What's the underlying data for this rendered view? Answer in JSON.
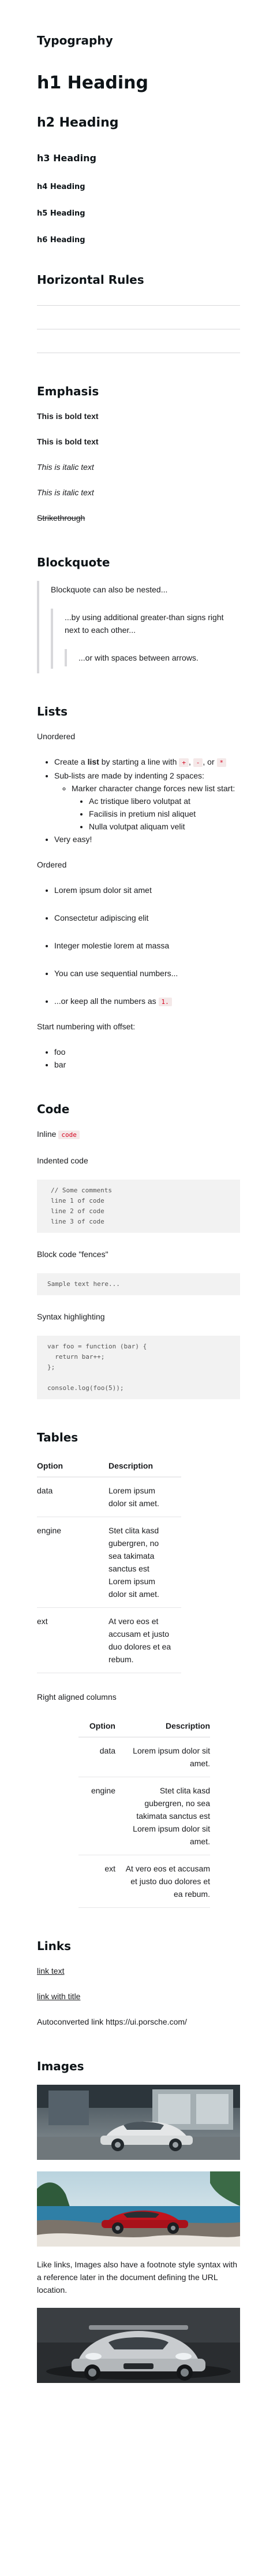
{
  "typography": {
    "title": "Typography",
    "h1": "h1 Heading",
    "h2": "h2 Heading",
    "h3": "h3 Heading",
    "h4": "h4 Heading",
    "h5": "h5 Heading",
    "h6": "h6 Heading"
  },
  "rules": {
    "title": "Horizontal Rules"
  },
  "emphasis": {
    "title": "Emphasis",
    "bold1": "This is bold text",
    "bold2": "This is bold text",
    "italic1": "This is italic text",
    "italic2": "This is italic text",
    "strike": "Strikethrough"
  },
  "blockquote": {
    "title": "Blockquote",
    "level1": "Blockquote can also be nested...",
    "level2": "...by using additional greater-than signs right next to each other...",
    "level3": "...or with spaces between arrows."
  },
  "lists": {
    "title": "Lists",
    "unordered_label": "Unordered",
    "ul_intro_pre": "Create a ",
    "ul_intro_bold": "list",
    "ul_intro_mid": " by starting a line with ",
    "ul_code1": "+",
    "ul_code2": "-",
    "ul_code3": "*",
    "ul_sep1": ", ",
    "ul_sep2": ", or ",
    "ul_sub": "Sub-lists are made by indenting 2 spaces:",
    "ul_sub_sub": "Marker character change forces new list start:",
    "ul_deep1": "Ac tristique libero volutpat at",
    "ul_deep2": "Facilisis in pretium nisl aliquet",
    "ul_deep3": "Nulla volutpat aliquam velit",
    "ul_last": "Very easy!",
    "ordered_label": "Ordered",
    "ol1": "Lorem ipsum dolor sit amet",
    "ol2": "Consectetur adipiscing elit",
    "ol3": "Integer molestie lorem at massa",
    "ol4": "You can use sequential numbers...",
    "ol5_pre": "...or keep all the numbers as ",
    "ol5_code": "1.",
    "offset_label": "Start numbering with offset:",
    "off1": "foo",
    "off2": "bar"
  },
  "code": {
    "title": "Code",
    "inline_label": "Inline ",
    "inline_code": "code",
    "indented_label": "Indented code",
    "indented": "// Some comments\nline 1 of code\nline 2 of code\nline 3 of code",
    "fences_label": "Block code \"fences\"",
    "fences": "Sample text here...",
    "syntax_label": "Syntax highlighting",
    "syntax": "var foo = function (bar) {\n  return bar++;\n};\n\nconsole.log(foo(5));"
  },
  "tables": {
    "title": "Tables",
    "headers": [
      "Option",
      "Description"
    ],
    "rows": [
      [
        "data",
        "Lorem ipsum dolor sit amet."
      ],
      [
        "engine",
        "Stet clita kasd gubergren, no sea takimata sanctus est Lorem ipsum dolor sit amet."
      ],
      [
        "ext",
        "At vero eos et accusam et justo duo dolores et ea rebum."
      ]
    ],
    "right_label": "Right aligned columns"
  },
  "links": {
    "title": "Links",
    "link1": "link text",
    "link2": "link with title",
    "autoconverted": "Autoconverted link https://ui.porsche.com/"
  },
  "images": {
    "title": "Images",
    "caption": "Like links, Images also have a footnote style syntax with a reference later in the document defining the URL location."
  }
}
